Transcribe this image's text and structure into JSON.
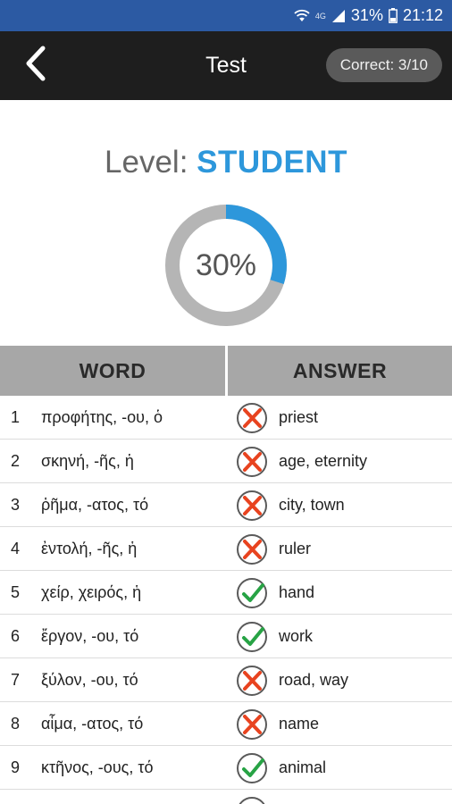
{
  "status_bar": {
    "battery": "31%",
    "time": "21:12",
    "network": "4G",
    "icons": [
      "wifi-icon",
      "signal-icon",
      "battery-icon"
    ]
  },
  "app_bar": {
    "back_icon": "chevron-left-icon",
    "title": "Test",
    "score": "Correct: 3/10"
  },
  "summary": {
    "level_label": "Level:",
    "level_value": "STUDENT",
    "progress_text": "30%",
    "progress_fraction": 0.3
  },
  "table": {
    "headers": {
      "word": "WORD",
      "answer": "ANSWER"
    },
    "rows": [
      {
        "num": "1",
        "word": "προφήτης, -ου, ὁ",
        "answer": "priest",
        "correct": false
      },
      {
        "num": "2",
        "word": "σκηνή, -ῆς, ἡ",
        "answer": "age, eternity",
        "correct": false
      },
      {
        "num": "3",
        "word": "ῥῆμα, -ατος, τό",
        "answer": "city, town",
        "correct": false
      },
      {
        "num": "4",
        "word": "ἐντολή, -ῆς, ἡ",
        "answer": "ruler",
        "correct": false
      },
      {
        "num": "5",
        "word": "χείρ, χειρός, ἡ",
        "answer": "hand",
        "correct": true
      },
      {
        "num": "6",
        "word": "ἔργον, -ου, τό",
        "answer": "work",
        "correct": true
      },
      {
        "num": "7",
        "word": "ξύλον, -ου, τό",
        "answer": "road, way",
        "correct": false
      },
      {
        "num": "8",
        "word": "αἷμα, -ατος, τό",
        "answer": "name",
        "correct": false
      },
      {
        "num": "9",
        "word": "κτῆνος, -ους, τό",
        "answer": "animal",
        "correct": true
      }
    ]
  },
  "colors": {
    "status_bar": "#2c5aa3",
    "app_bar": "#1e1e1e",
    "accent": "#2d97db",
    "ring_track": "#b5b5b5",
    "correct": "#27a345",
    "wrong": "#e8431f"
  }
}
